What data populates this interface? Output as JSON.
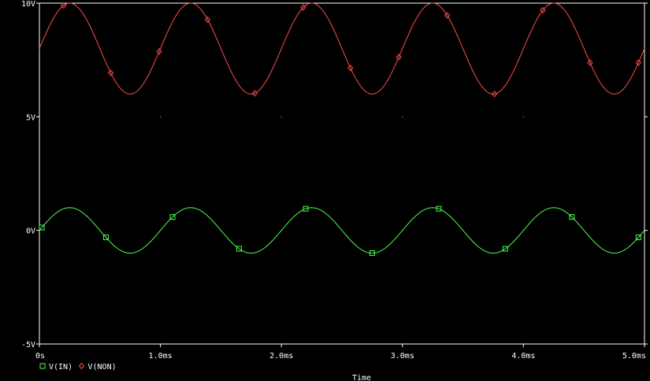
{
  "chart_data": {
    "type": "line",
    "title": "",
    "xlabel": "Time",
    "ylabel": "",
    "xlim": [
      0,
      5.0
    ],
    "ylim": [
      -5,
      10
    ],
    "x_unit": "ms",
    "x_ticks": [
      {
        "value": 0,
        "label": "0s"
      },
      {
        "value": 1.0,
        "label": "1.0ms"
      },
      {
        "value": 2.0,
        "label": "2.0ms"
      },
      {
        "value": 3.0,
        "label": "3.0ms"
      },
      {
        "value": 4.0,
        "label": "4.0ms"
      },
      {
        "value": 5.0,
        "label": "5.0ms"
      }
    ],
    "y_ticks": [
      {
        "value": 10,
        "label": "10V"
      },
      {
        "value": 5,
        "label": "5V"
      },
      {
        "value": 0,
        "label": "0V"
      },
      {
        "value": -5,
        "label": "-5V"
      }
    ],
    "grid": false,
    "legend_position": "bottom-left",
    "background": "#000000",
    "axis_color": "#ffffff",
    "series": [
      {
        "name": "V(IN)",
        "color": "#4cff4c",
        "marker": "square",
        "waveform": {
          "shape": "sine",
          "offset": 0,
          "amplitude": 1,
          "frequency_khz": 1.0,
          "phase_deg": 0
        },
        "markers_x": [
          0.02,
          0.55,
          1.1,
          1.65,
          2.2,
          2.75,
          3.3,
          3.85,
          4.4,
          4.95
        ]
      },
      {
        "name": "V(NON)",
        "color": "#ff4c4c",
        "marker": "diamond",
        "waveform": {
          "shape": "sine",
          "offset": 8,
          "amplitude": 2,
          "frequency_khz": 1.0,
          "phase_deg": 0
        },
        "markers_x": [
          0.2,
          0.59,
          0.99,
          1.39,
          1.78,
          2.18,
          2.57,
          2.97,
          3.37,
          3.76,
          4.16,
          4.55,
          4.95
        ]
      }
    ]
  }
}
